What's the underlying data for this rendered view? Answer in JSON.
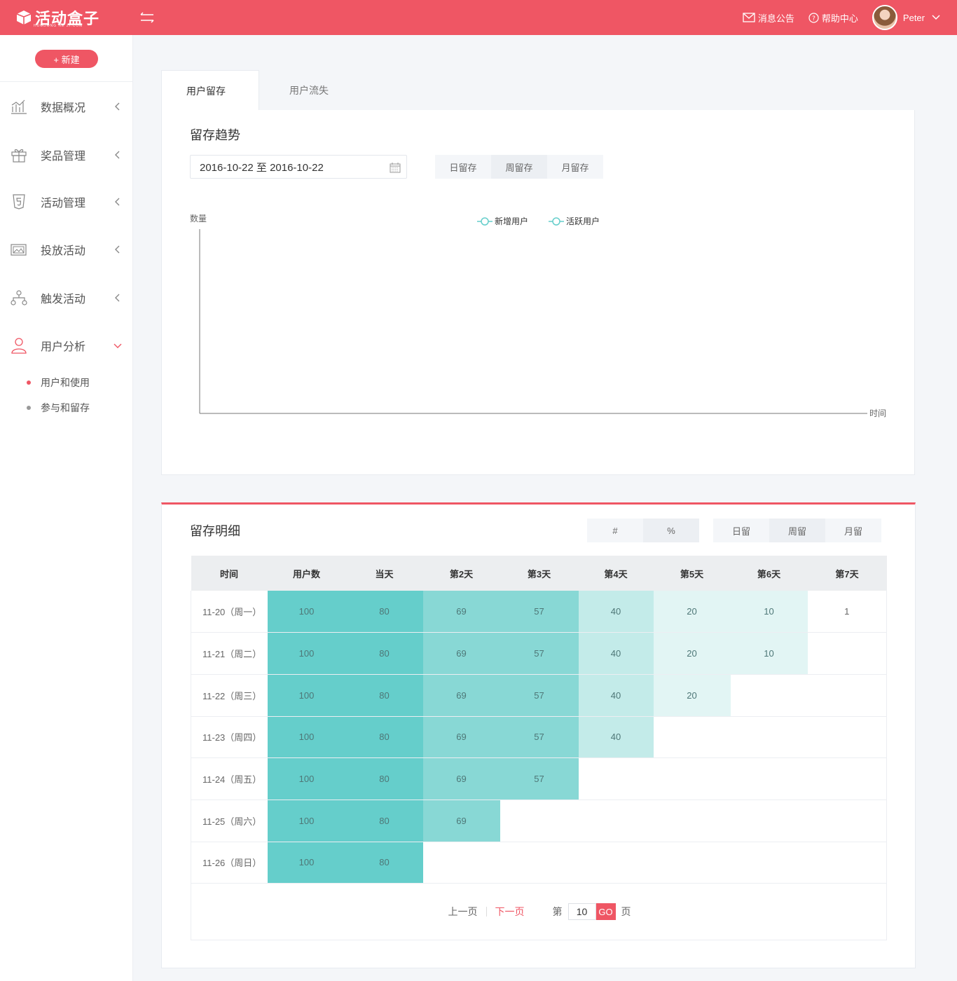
{
  "header": {
    "logo_text": "活动盒子",
    "logo_sub": "HUODONG HE ZI.COM",
    "notice_label": "消息公告",
    "help_label": "帮助中心",
    "user_name": "Peter"
  },
  "sidebar": {
    "new_button": "+  新建",
    "items": [
      {
        "label": "数据概况",
        "icon": "chart-line-icon"
      },
      {
        "label": "奖品管理",
        "icon": "gift-icon"
      },
      {
        "label": "活动管理",
        "icon": "html5-icon"
      },
      {
        "label": "投放活动",
        "icon": "image-icon"
      },
      {
        "label": "触发活动",
        "icon": "flow-icon"
      },
      {
        "label": "用户分析",
        "icon": "user-icon"
      }
    ],
    "sub_items": [
      {
        "label": "用户和使用",
        "active": true
      },
      {
        "label": "参与和留存",
        "active": false
      }
    ]
  },
  "tabs": [
    {
      "label": "用户留存",
      "active": true
    },
    {
      "label": "用户流失",
      "active": false
    }
  ],
  "trend": {
    "title": "留存趋势",
    "date_range": "2016-10-22 至 2016-10-22",
    "segments": [
      "日留存",
      "周留存",
      "月留存"
    ],
    "selected_segment": 1
  },
  "chart_data": {
    "type": "line",
    "ylabel": "数量",
    "xlabel": "时间",
    "series": [
      {
        "name": "新增用户",
        "values": []
      },
      {
        "name": "活跃用户",
        "values": []
      }
    ],
    "legend": "top-center",
    "grid": false
  },
  "detail": {
    "title": "留存明细",
    "value_toggle": [
      "#",
      "%"
    ],
    "value_selected": 1,
    "period_toggle": [
      "日留",
      "周留",
      "月留"
    ],
    "period_selected": 1,
    "columns": [
      "时间",
      "用户数",
      "当天",
      "第2天",
      "第3天",
      "第4天",
      "第5天",
      "第6天",
      "第7天"
    ],
    "rows": [
      {
        "time": "11-20（周一）",
        "cells": [
          "100",
          "80",
          "69",
          "57",
          "40",
          "20",
          "10",
          "1"
        ]
      },
      {
        "time": "11-21（周二）",
        "cells": [
          "100",
          "80",
          "69",
          "57",
          "40",
          "20",
          "10"
        ]
      },
      {
        "time": "11-22（周三）",
        "cells": [
          "100",
          "80",
          "69",
          "57",
          "40",
          "20"
        ]
      },
      {
        "time": "11-23（周四）",
        "cells": [
          "100",
          "80",
          "69",
          "57",
          "40"
        ]
      },
      {
        "time": "11-24（周五）",
        "cells": [
          "100",
          "80",
          "69",
          "57"
        ]
      },
      {
        "time": "11-25（周六）",
        "cells": [
          "100",
          "80",
          "69"
        ]
      },
      {
        "time": "11-26（周日）",
        "cells": [
          "100",
          "80"
        ]
      }
    ]
  },
  "pager": {
    "prev": "上一页",
    "next": "下一页",
    "page_prefix": "第",
    "page_value": "10",
    "go": "GO",
    "page_suffix": "页"
  },
  "colors": {
    "brand": "#ef5664",
    "teal_1": "#65cecb",
    "teal_2": "#88d8d5",
    "teal_3": "#c3ebe9",
    "teal_4": "#e2f5f4"
  }
}
